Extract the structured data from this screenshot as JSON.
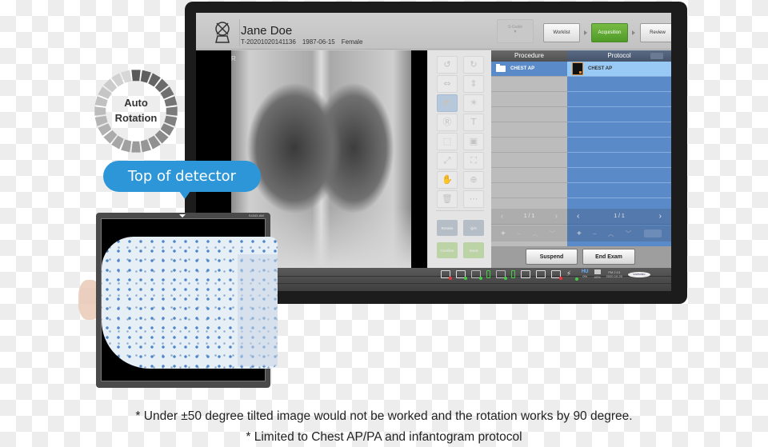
{
  "app": {
    "patient": {
      "name": "Jane Doe",
      "id": "T-20201020141136",
      "dob": "1987-06-15",
      "sex": "Female"
    },
    "sguide": {
      "label": "S-Guide",
      "arrow": "▼"
    },
    "workflow": {
      "steps": [
        {
          "label": "Worklist",
          "active": false
        },
        {
          "label": "Acquisition",
          "active": true
        },
        {
          "label": "Review",
          "active": false
        }
      ]
    },
    "image_view": {
      "orientation_marker": "R"
    },
    "tools": [
      {
        "icon": "rotate-ccw-icon",
        "glyph": "↺"
      },
      {
        "icon": "rotate-cw-icon",
        "glyph": "↻"
      },
      {
        "icon": "flip-horizontal-icon",
        "glyph": "⇔"
      },
      {
        "icon": "flip-vertical-icon",
        "glyph": "⇕"
      },
      {
        "icon": "invert-icon",
        "glyph": "◩",
        "selected": true
      },
      {
        "icon": "brightness-icon",
        "glyph": "☀"
      },
      {
        "icon": "marker-r-icon",
        "glyph": "Ⓡ"
      },
      {
        "icon": "text-icon",
        "glyph": "T"
      },
      {
        "icon": "crop-icon",
        "glyph": "⬚"
      },
      {
        "icon": "mask-icon",
        "glyph": "▣"
      },
      {
        "icon": "fit-icon",
        "glyph": "⤢"
      },
      {
        "icon": "fullscreen-icon",
        "glyph": "⛶"
      },
      {
        "icon": "pan-icon",
        "glyph": "✋"
      },
      {
        "icon": "zoom-icon",
        "glyph": "⊕"
      },
      {
        "icon": "delete-icon",
        "glyph": "🗑"
      },
      {
        "icon": "more-icon",
        "glyph": "⋯"
      }
    ],
    "actions": {
      "retake": "Retake",
      "qa": "Q/A",
      "confirm": "Confirm",
      "send": "Send"
    },
    "procedure": {
      "header": "Procedure",
      "items": [
        "CHEST AP"
      ],
      "page": "1 / 1"
    },
    "protocol": {
      "header": "Protocol",
      "items": [
        "CHEST AP"
      ],
      "page": "1 / 1"
    },
    "pager": {
      "prev": "‹",
      "next": "›",
      "add": "+",
      "remove": "−",
      "up": "︿",
      "down": "﹀"
    },
    "buttons": {
      "suspend": "Suspend",
      "end_exam": "End Exam"
    },
    "statusbar": {
      "hu_label": "HU",
      "hu_value": "0%",
      "storage_value": "40%",
      "time": "PM 2:13",
      "date": "2020-10-20",
      "brand": "SAMSUNG"
    }
  },
  "overlay": {
    "auto_rotation": [
      "Auto",
      "Rotation"
    ],
    "callout": "Top of detector",
    "detector_model": "S4343-AW"
  },
  "footnotes": [
    "* Under ±50 degree tilted image would not be worked  and the rotation works by 90 degree.",
    "* Limited to Chest AP/PA and infantogram protocol"
  ]
}
